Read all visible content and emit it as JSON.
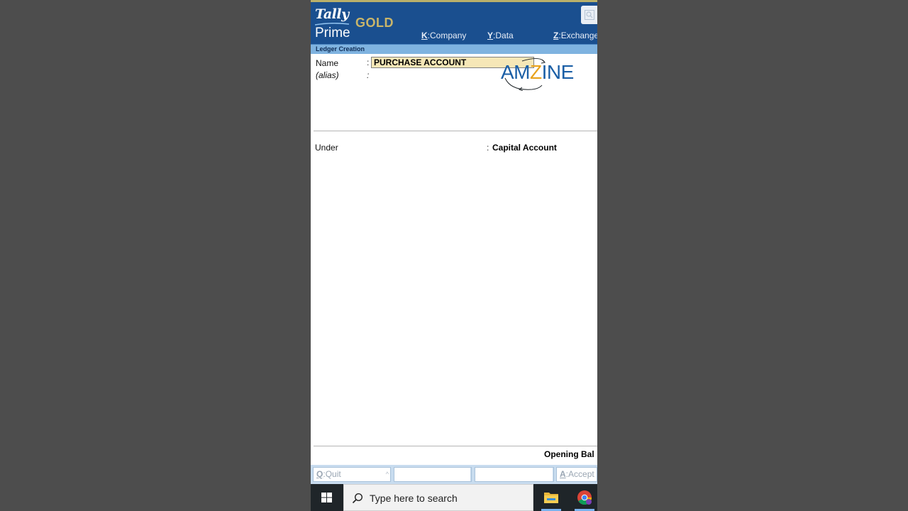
{
  "app": {
    "brand_word": "Tally",
    "product_word": "Prime",
    "edition": "GOLD"
  },
  "menu": [
    {
      "key": "K",
      "label": "Company"
    },
    {
      "key": "Y",
      "label": "Data"
    },
    {
      "key": "Z",
      "label": "Exchange"
    }
  ],
  "screen_title": "Ledger Creation",
  "form": {
    "name_label": "Name",
    "name_colon": ":",
    "name_value": "PURCHASE ACCOUNT",
    "alias_label": "(alias)",
    "alias_colon": ":",
    "under_label": "Under",
    "under_colon": ":",
    "under_value": "Capital Account",
    "opening_balance_label": "Opening Bal"
  },
  "watermark": {
    "text_before": "AM",
    "text_z": "Z",
    "text_after": "INE"
  },
  "button_bar": [
    {
      "key": "Q",
      "label": "Quit"
    },
    {
      "key": "",
      "label": ""
    },
    {
      "key": "",
      "label": ""
    },
    {
      "key": "A",
      "label": "Accept"
    }
  ],
  "taskbar": {
    "search_placeholder": "Type here to search",
    "apps": [
      "file-explorer-icon",
      "chrome-icon"
    ]
  },
  "colors": {
    "header": "#1a4f8f",
    "title_bar": "#7fb3e0",
    "name_field": "#f6e7b7",
    "gold": "#c9b56a"
  }
}
